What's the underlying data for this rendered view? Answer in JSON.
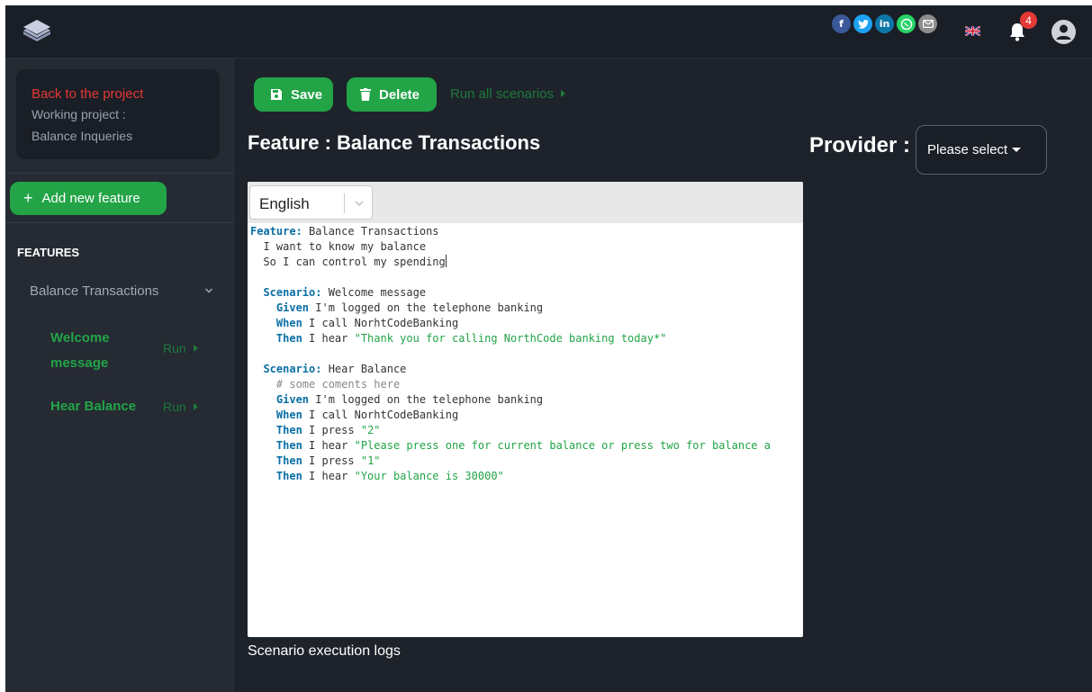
{
  "header": {
    "logo_icon": "layers-icon",
    "social": [
      {
        "name": "facebook",
        "glyph": "f",
        "color": "#3b5998"
      },
      {
        "name": "twitter",
        "glyph": "t",
        "color": "#1da1f2"
      },
      {
        "name": "linkedin",
        "glyph": "in",
        "color": "#0e76a8"
      },
      {
        "name": "whatsapp",
        "glyph": "w",
        "color": "#25d366"
      },
      {
        "name": "email",
        "glyph": "@",
        "color": "#8c8c8c"
      }
    ],
    "notification_count": "4"
  },
  "sidebar": {
    "back_link": "Back to the project",
    "working_project_label": "Working project :",
    "working_project_name": "Balance Inqueries",
    "add_feature_label": "Add new feature",
    "features_heading": "FEATURES",
    "feature_name": "Balance Transactions",
    "scenarios": [
      {
        "name": "Welcome message",
        "run_label": "Run"
      },
      {
        "name": "Hear Balance",
        "run_label": "Run"
      }
    ]
  },
  "toolbar": {
    "save_label": "Save",
    "delete_label": "Delete",
    "run_all_label": "Run all scenarios"
  },
  "main": {
    "feature_title": "Feature : Balance Transactions",
    "provider_label": "Provider :",
    "provider_select": "Please select",
    "language": "English",
    "logs_label": "Scenario execution logs"
  },
  "editor": {
    "lines": [
      [
        {
          "t": "Feature:",
          "c": "kw"
        },
        {
          "t": " Balance Transactions"
        }
      ],
      [
        {
          "t": "  I want to know my balance"
        }
      ],
      [
        {
          "t": "  So I can control my spending"
        },
        {
          "cursor": true
        }
      ],
      [],
      [
        {
          "t": "  "
        },
        {
          "t": "Scenario:",
          "c": "kw"
        },
        {
          "t": " Welcome message"
        }
      ],
      [
        {
          "t": "    "
        },
        {
          "t": "Given",
          "c": "kw"
        },
        {
          "t": " I'm logged on the telephone banking"
        }
      ],
      [
        {
          "t": "    "
        },
        {
          "t": "When",
          "c": "kw"
        },
        {
          "t": " I call NorhtCodeBanking"
        }
      ],
      [
        {
          "t": "    "
        },
        {
          "t": "Then",
          "c": "kw"
        },
        {
          "t": " I hear "
        },
        {
          "t": "\"Thank you for calling NorthCode banking today*\"",
          "c": "str"
        }
      ],
      [],
      [
        {
          "t": "  "
        },
        {
          "t": "Scenario:",
          "c": "kw"
        },
        {
          "t": " Hear Balance"
        }
      ],
      [
        {
          "t": "    "
        },
        {
          "t": "# some coments here",
          "c": "cmt"
        }
      ],
      [
        {
          "t": "    "
        },
        {
          "t": "Given",
          "c": "kw"
        },
        {
          "t": " I'm logged on the telephone banking"
        }
      ],
      [
        {
          "t": "    "
        },
        {
          "t": "When",
          "c": "kw"
        },
        {
          "t": " I call NorhtCodeBanking"
        }
      ],
      [
        {
          "t": "    "
        },
        {
          "t": "Then",
          "c": "kw"
        },
        {
          "t": " I press "
        },
        {
          "t": "\"2\"",
          "c": "str"
        }
      ],
      [
        {
          "t": "    "
        },
        {
          "t": "Then",
          "c": "kw"
        },
        {
          "t": " I hear "
        },
        {
          "t": "\"Please press one for current balance or press two for balance a",
          "c": "str"
        }
      ],
      [
        {
          "t": "    "
        },
        {
          "t": "Then",
          "c": "kw"
        },
        {
          "t": " I press "
        },
        {
          "t": "\"1\"",
          "c": "str"
        }
      ],
      [
        {
          "t": "    "
        },
        {
          "t": "Then",
          "c": "kw"
        },
        {
          "t": " I hear "
        },
        {
          "t": "\"Your balance is 30000\"",
          "c": "str"
        }
      ]
    ]
  }
}
